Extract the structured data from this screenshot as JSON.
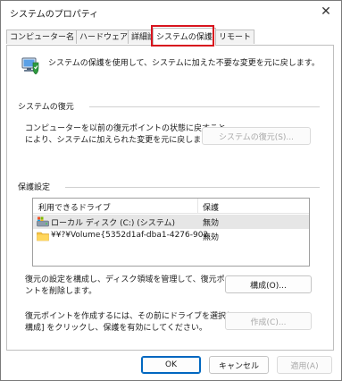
{
  "window": {
    "title": "システムのプロパティ",
    "close_glyph": "✕"
  },
  "tabs": [
    {
      "label": "コンピューター名",
      "active": false
    },
    {
      "label": "ハードウェア",
      "active": false
    },
    {
      "label": "詳細設定",
      "active": false
    },
    {
      "label": "システムの保護",
      "active": true
    },
    {
      "label": "リモート",
      "active": false
    }
  ],
  "intro": {
    "icon": "system-protection-icon",
    "text": "システムの保護を使用して、システムに加えた不要な変更を元に戻します。"
  },
  "restore_section": {
    "label": "システムの復元",
    "line1": "コンピューターを以前の復元ポイントの状態に戻すこと",
    "line2": "により、システムに加えられた変更を元に戻します。",
    "button": "システムの復元(S)..."
  },
  "settings_section": {
    "label": "保護設定",
    "columns": [
      "利用できるドライブ",
      "保護"
    ],
    "drives": [
      {
        "icon": "system-drive-icon",
        "name": "ローカル ディスク (C:) (システム)",
        "protection": "無効",
        "selected": true
      },
      {
        "icon": "folder-icon",
        "name": "¥¥?¥Volume{5352d1af-dba1-4276-902...",
        "protection": "無効",
        "selected": false
      }
    ],
    "configure_line1": "復元の設定を構成し、ディスク領域を管理して、復元ポイ",
    "configure_line2": "ントを削除します。",
    "configure_button": "構成(O)...",
    "create_line1": "復元ポイントを作成するには、その前にドライブを選択して [",
    "create_line2": "構成] をクリックし、保護を有効にしてください。",
    "create_button": "作成(C)..."
  },
  "footer": {
    "ok": "OK",
    "cancel": "キャンセル",
    "apply": "適用(A)"
  },
  "colors": {
    "highlight": "#d8141e",
    "accent": "#0067c0",
    "disabled_text": "#a8a8a8"
  }
}
